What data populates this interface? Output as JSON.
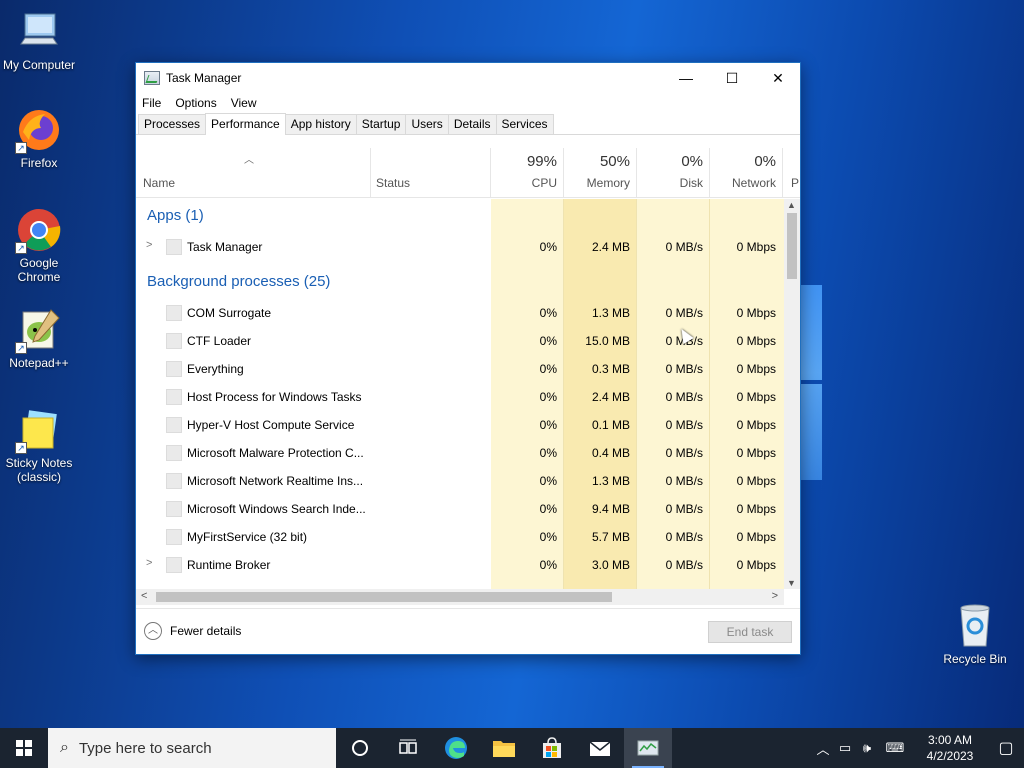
{
  "desktop": {
    "icons": [
      {
        "label": "My Computer"
      },
      {
        "label": "Firefox"
      },
      {
        "label": "Google Chrome"
      },
      {
        "label": "Notepad++"
      },
      {
        "label": "Sticky Notes (classic)"
      },
      {
        "label": "Recycle Bin"
      }
    ]
  },
  "window": {
    "title": "Task Manager",
    "controls": {
      "minimize": "—",
      "maximize": "☐",
      "close": "✕"
    },
    "menu": [
      "File",
      "Options",
      "View"
    ],
    "tabs": [
      "Processes",
      "Performance",
      "App history",
      "Startup",
      "Users",
      "Details",
      "Services"
    ],
    "active_tab": "Performance",
    "columns": {
      "name": "Name",
      "status": "Status",
      "cpu": {
        "pct": "99%",
        "label": "CPU"
      },
      "memory": {
        "pct": "50%",
        "label": "Memory"
      },
      "disk": {
        "pct": "0%",
        "label": "Disk"
      },
      "network": {
        "pct": "0%",
        "label": "Network"
      },
      "more": "P"
    },
    "groups": {
      "apps": "Apps (1)",
      "background": "Background processes (25)"
    },
    "apps": [
      {
        "name": "Task Manager",
        "cpu": "0%",
        "memory": "2.4 MB",
        "disk": "0 MB/s",
        "network": "0 Mbps"
      }
    ],
    "background": [
      {
        "name": "COM Surrogate",
        "cpu": "0%",
        "memory": "1.3 MB",
        "disk": "0 MB/s",
        "network": "0 Mbps"
      },
      {
        "name": "CTF Loader",
        "cpu": "0%",
        "memory": "15.0 MB",
        "disk": "0 MB/s",
        "network": "0 Mbps"
      },
      {
        "name": "Everything",
        "cpu": "0%",
        "memory": "0.3 MB",
        "disk": "0 MB/s",
        "network": "0 Mbps"
      },
      {
        "name": "Host Process for Windows Tasks",
        "cpu": "0%",
        "memory": "2.4 MB",
        "disk": "0 MB/s",
        "network": "0 Mbps"
      },
      {
        "name": "Hyper-V Host Compute Service",
        "cpu": "0%",
        "memory": "0.1 MB",
        "disk": "0 MB/s",
        "network": "0 Mbps"
      },
      {
        "name": "Microsoft Malware Protection C...",
        "cpu": "0%",
        "memory": "0.4 MB",
        "disk": "0 MB/s",
        "network": "0 Mbps"
      },
      {
        "name": "Microsoft Network Realtime Ins...",
        "cpu": "0%",
        "memory": "1.3 MB",
        "disk": "0 MB/s",
        "network": "0 Mbps"
      },
      {
        "name": "Microsoft Windows Search Inde...",
        "cpu": "0%",
        "memory": "9.4 MB",
        "disk": "0 MB/s",
        "network": "0 Mbps"
      },
      {
        "name": "MyFirstService (32 bit)",
        "cpu": "0%",
        "memory": "5.7 MB",
        "disk": "0 MB/s",
        "network": "0 Mbps"
      },
      {
        "name": "Runtime Broker",
        "cpu": "0%",
        "memory": "3.0 MB",
        "disk": "0 MB/s",
        "network": "0 Mbps"
      }
    ],
    "footer": {
      "fewer_details": "Fewer details",
      "end_task": "End task"
    }
  },
  "taskbar": {
    "search_placeholder": "Type here to search",
    "clock_time": "3:00 AM",
    "clock_date": "4/2/2023"
  },
  "colors": {
    "group_text": "#1a5fb4",
    "heat_light": "#fdf6d3",
    "heat_mid": "#f9eab0"
  }
}
